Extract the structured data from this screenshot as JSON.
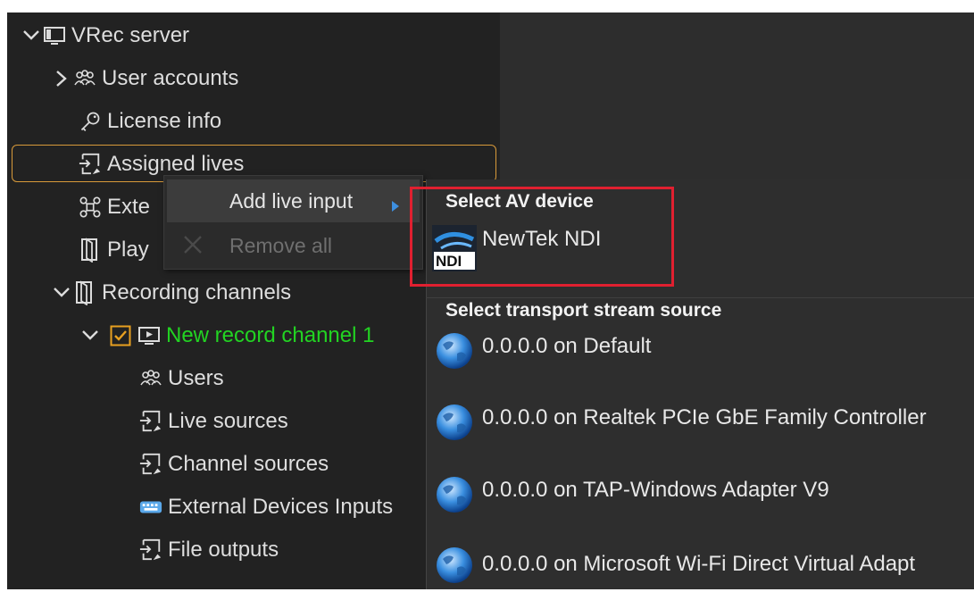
{
  "tree": {
    "root": {
      "label": "VRec server"
    },
    "user_accounts": {
      "label": "User accounts"
    },
    "license_info": {
      "label": "License info"
    },
    "assigned_lives": {
      "label": "Assigned lives"
    },
    "external_partial": {
      "label": "Exte"
    },
    "play_partial": {
      "label": "Play"
    },
    "recording_channels": {
      "label": "Recording channels"
    },
    "new_record_channel": {
      "label": "New record channel 1",
      "checked": true,
      "color": "#22d422"
    },
    "users": {
      "label": "Users"
    },
    "live_sources": {
      "label": "Live sources"
    },
    "channel_sources": {
      "label": "Channel sources"
    },
    "external_devices_inputs": {
      "label": "External Devices Inputs"
    },
    "file_outputs": {
      "label": "File outputs"
    }
  },
  "context_menu": {
    "add_live_input": "Add live input",
    "remove_all": "Remove all"
  },
  "submenu": {
    "av_header": "Select AV device",
    "av_devices": [
      "NewTek NDI"
    ],
    "ndi_logo_text": "NDI",
    "ts_header": "Select transport stream source",
    "ts_sources": [
      "0.0.0.0 on Default",
      "0.0.0.0 on Realtek PCIe GbE Family Controller",
      "0.0.0.0 on TAP-Windows Adapter V9",
      "0.0.0.0 on Microsoft Wi-Fi Direct Virtual Adapt"
    ]
  },
  "colors": {
    "selection_border": "#d89a3a",
    "highlight_box": "#e02030",
    "checkbox": "#e8a020",
    "submenu_arrow": "#3d8fe0"
  },
  "icons": {
    "root": "monitor-icon",
    "user_accounts": "users-group-icon",
    "license_info": "key-icon",
    "assigned_lives": "live-input-icon",
    "external": "network-icon",
    "play": "playlist-icon",
    "recording_channels": "playlist-icon",
    "new_record_channel": "screen-play-icon",
    "external_devices_inputs": "keyboard-icon",
    "remove_all": "close-icon",
    "ts_source": "globe-icon"
  }
}
